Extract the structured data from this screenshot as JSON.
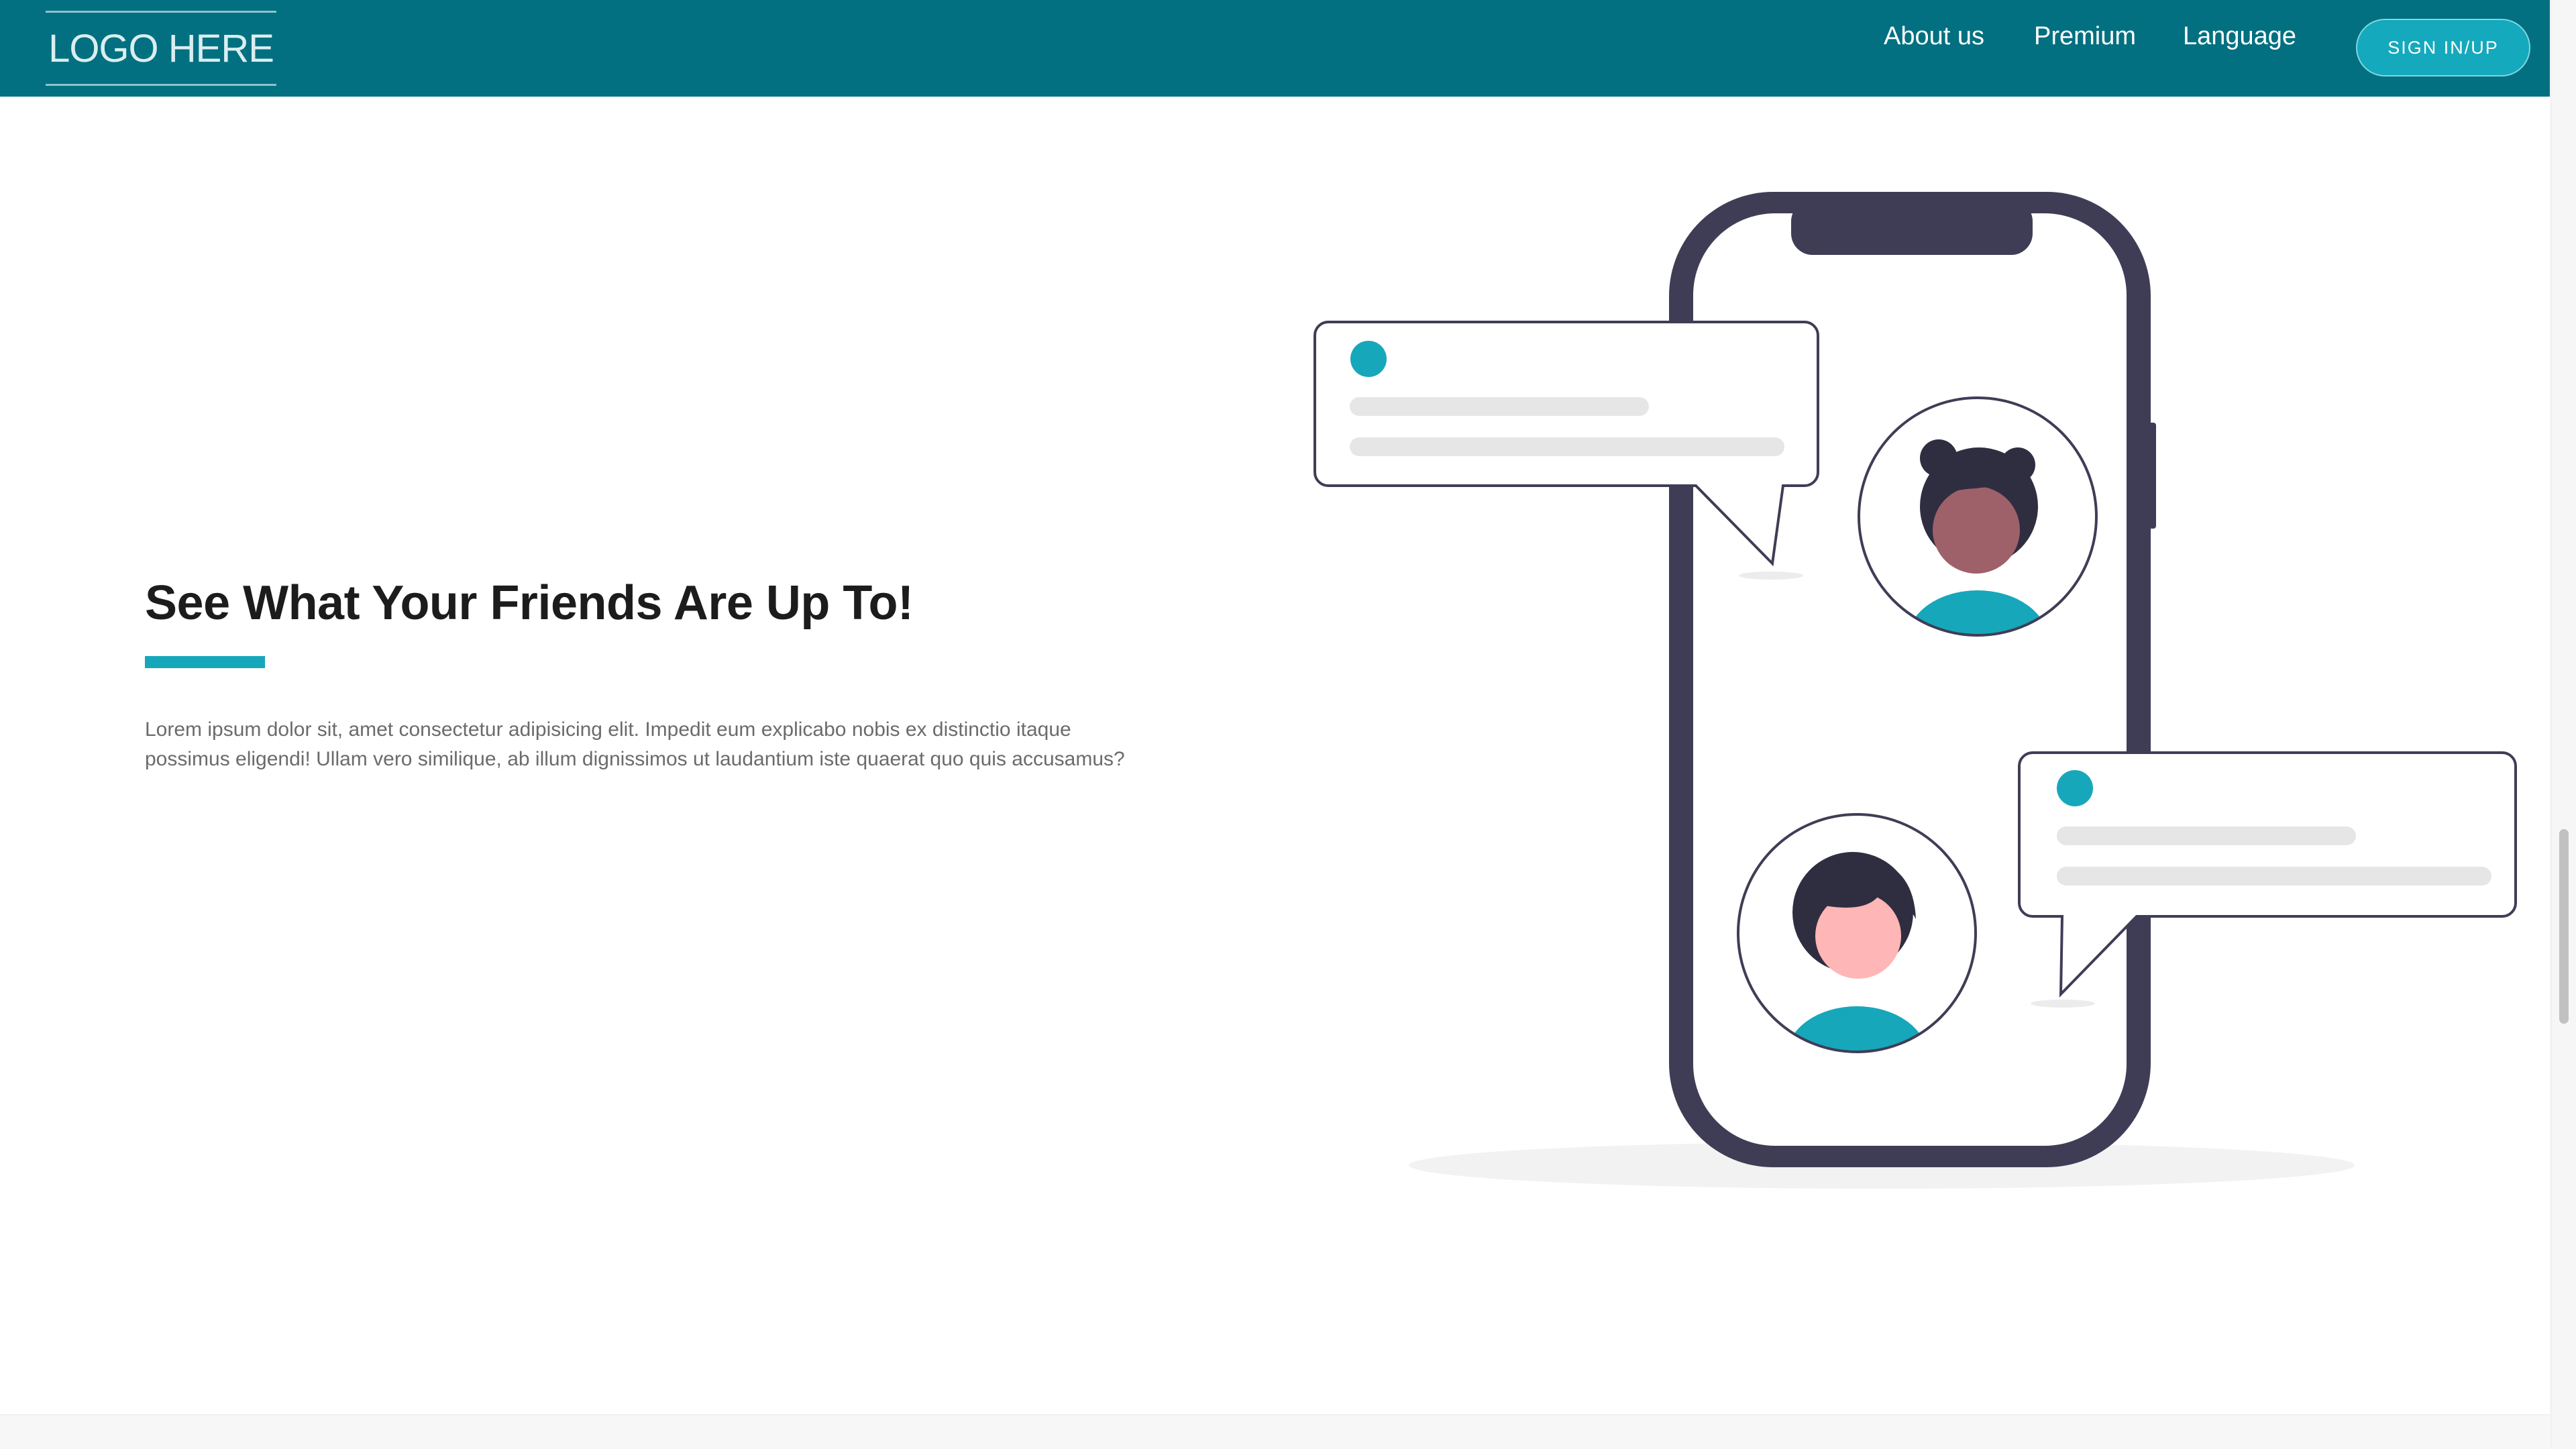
{
  "header": {
    "logo_text": "LOGO HERE",
    "nav": {
      "about": "About us",
      "premium": "Premium",
      "language": "Language"
    },
    "signin_label": "SIGN IN/UP"
  },
  "hero": {
    "title": "See What Your Friends Are Up To!",
    "description": "Lorem ipsum dolor sit, amet consectetur adipisicing elit. Impedit eum explicabo nobis ex distinctio itaque possimus eligendi! Ullam vero similique, ab illum dignissimos ut laudantium iste quaerat quo quis accusamus?"
  },
  "colors": {
    "header_bg": "#027080",
    "accent": "#17a7bb",
    "phone_frame": "#3f3d56",
    "skin_dark": "#9e616a",
    "skin_light": "#ffb6b6"
  },
  "icons": {
    "illustration": "phone-chat-illustration"
  }
}
